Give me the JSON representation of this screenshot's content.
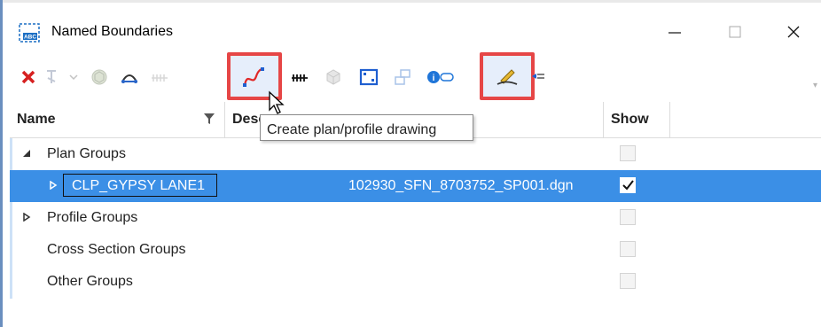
{
  "window": {
    "title": "Named Boundaries",
    "icon": "named-boundaries-app-icon",
    "icon_text": "ABC",
    "controls": [
      "minimize-icon",
      "maximize-icon",
      "close-icon"
    ]
  },
  "toolbar": {
    "buttons": [
      {
        "name": "delete",
        "icon": "red-x-icon",
        "enabled": true
      },
      {
        "name": "civil-tools-dropdown",
        "icon": "civil-tools-icon",
        "enabled": false
      },
      {
        "name": "boundary-3d",
        "icon": "cube-globe-icon",
        "enabled": false
      },
      {
        "name": "civil-plan",
        "icon": "arch-icon",
        "enabled": true
      },
      {
        "name": "profile-grid",
        "icon": "grid-icon",
        "enabled": false
      },
      {
        "name": "create-plan-profile-drawing",
        "icon": "red-curve-icon",
        "enabled": true,
        "highlighted": true
      },
      {
        "name": "cross-section",
        "icon": "dark-grid-icon",
        "enabled": true
      },
      {
        "name": "3d-model",
        "icon": "3d-box-icon",
        "enabled": false
      },
      {
        "name": "drawing-boundary",
        "icon": "blue-frame-icon",
        "enabled": true
      },
      {
        "name": "group-boundaries",
        "icon": "boxes-icon",
        "enabled": false
      },
      {
        "name": "properties",
        "icon": "info-toggle-icon",
        "enabled": true
      },
      {
        "name": "draw-boundary",
        "icon": "pencil-line-icon",
        "enabled": true,
        "highlighted": true
      },
      {
        "name": "more",
        "icon": "list-arrow-icon",
        "enabled": true
      }
    ],
    "highlight_color": "#e64646"
  },
  "tooltip": "Create plan/profile drawing",
  "grid": {
    "columns": [
      "Name",
      "Description",
      "Show"
    ],
    "column_labels_visible": [
      "Name",
      "Desc",
      "Show"
    ],
    "rows": [
      {
        "label": "Plan Groups",
        "level": 0,
        "expander": "expanded",
        "show": false
      },
      {
        "label": "CLP_GYPSY LANE1",
        "level": 1,
        "expander": "collapsed",
        "description": "102930_SFN_8703752_SP001.dgn",
        "show": true,
        "selected": true,
        "editing": true
      },
      {
        "label": "Profile Groups",
        "level": 0,
        "expander": "collapsed",
        "show": false
      },
      {
        "label": "Cross Section Groups",
        "level": 0,
        "expander": "none",
        "show": false
      },
      {
        "label": "Other Groups",
        "level": 0,
        "expander": "none",
        "show": false
      }
    ],
    "selection_color": "#3b8fe6"
  }
}
